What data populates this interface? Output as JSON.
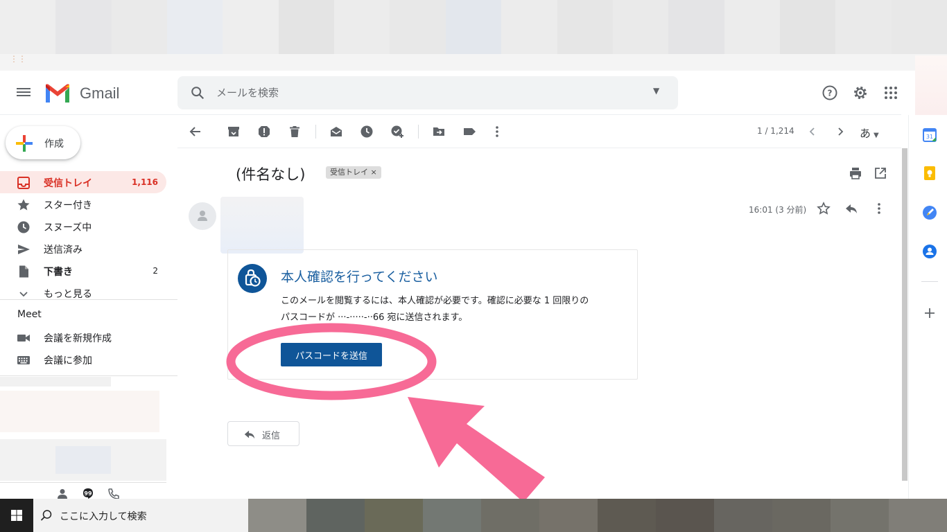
{
  "header": {
    "app_name": "Gmail",
    "search_placeholder": "メールを検索"
  },
  "sidebar": {
    "compose_label": "作成",
    "items": [
      {
        "label": "受信トレイ",
        "count": "1,116"
      },
      {
        "label": "スター付き",
        "count": ""
      },
      {
        "label": "スヌーズ中",
        "count": ""
      },
      {
        "label": "送信済み",
        "count": ""
      },
      {
        "label": "下書き",
        "count": "2"
      },
      {
        "label": "もっと見る",
        "count": ""
      }
    ],
    "meet": {
      "title": "Meet",
      "items": [
        {
          "label": "会議を新規作成"
        },
        {
          "label": "会議に参加"
        }
      ]
    }
  },
  "toolbar": {
    "pager": "1 / 1,214",
    "input_tool": "あ"
  },
  "message": {
    "subject": "(件名なし)",
    "label": "受信トレイ",
    "time": "16:01 (3 分前)",
    "card": {
      "title": "本人確認を行ってください",
      "body_line1": "このメールを閲覧するには、本人確認が必要です。確認に必要な 1 回限りの",
      "body_line2": "パスコードが ···-·····-··66 宛に送信されます。",
      "button": "パスコードを送信"
    },
    "reply_label": "返信"
  },
  "taskbar": {
    "search_text": "ここに入力して検索"
  },
  "colors": {
    "gmail_red": "#d93025",
    "card_blue": "#0f5598",
    "annotation_pink": "#f76a96"
  }
}
